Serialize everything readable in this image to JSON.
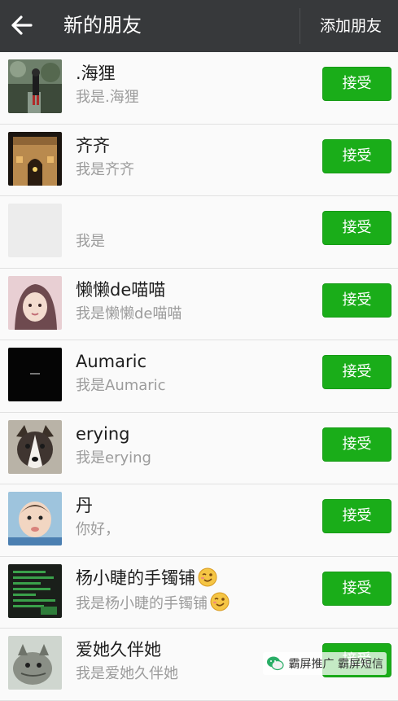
{
  "header": {
    "title": "新的朋友",
    "add_friend_label": "添加朋友"
  },
  "friend_requests": [
    {
      "name": ".海狸",
      "message": "我是.海狸",
      "button": "接受",
      "avatar": "forest-path-photo",
      "emoji": false
    },
    {
      "name": "齐齐",
      "message": "我是齐齐",
      "button": "接受",
      "avatar": "arch-monument-photo",
      "emoji": false
    },
    {
      "name": "",
      "message": "我是",
      "button": "接受",
      "avatar": "blank",
      "emoji": false
    },
    {
      "name": "懒懒de喵喵",
      "message": "我是懒懒de喵喵",
      "button": "接受",
      "avatar": "girl-portrait-photo",
      "emoji": false
    },
    {
      "name": "Aumaric",
      "message": "我是Aumaric",
      "button": "接受",
      "avatar": "black-square",
      "emoji": false
    },
    {
      "name": "erying",
      "message": "我是erying",
      "button": "接受",
      "avatar": "husky-dog-photo",
      "emoji": false
    },
    {
      "name": "丹",
      "message": "你好，",
      "button": "接受",
      "avatar": "baby-photo",
      "emoji": false
    },
    {
      "name": "杨小睫的手镯铺",
      "message": "我是杨小睫的手镯铺",
      "button": "接受",
      "avatar": "green-text-poster",
      "emoji": true
    },
    {
      "name": "爱她久伴她",
      "message": "我是爱她久伴她",
      "button": "接受",
      "avatar": "cat-photo",
      "emoji": false
    }
  ],
  "watermark": {
    "text": "霸屏推广 霸屏短信"
  },
  "colors": {
    "header_bg": "#37393b",
    "accept_green": "#1aad19",
    "row_bg": "#fafafa",
    "secondary_text": "#9c9c9c"
  },
  "icons": [
    "back-arrow-icon",
    "wink-emoji-icon",
    "wechat-logo-icon"
  ]
}
